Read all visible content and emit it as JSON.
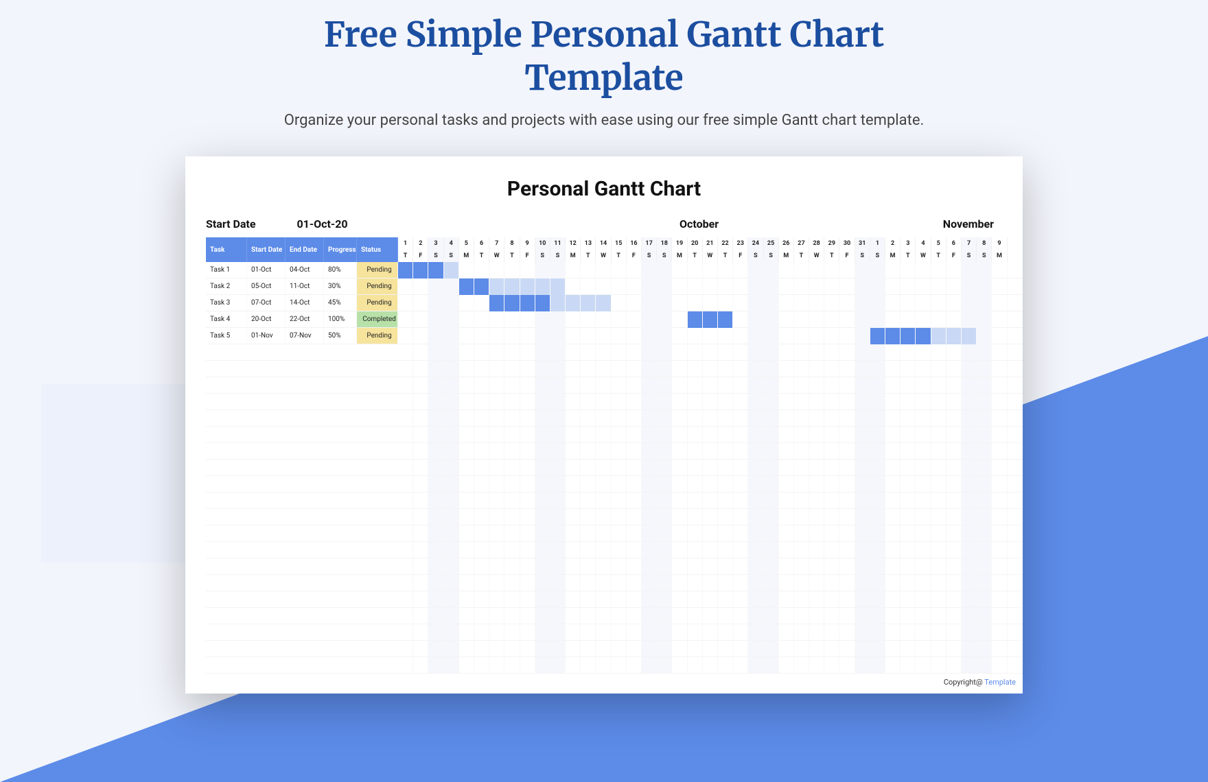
{
  "header": {
    "title": "Free Simple Personal Gantt Chart Template",
    "subtitle": "Organize your personal tasks and projects with ease using our free simple Gantt chart template."
  },
  "preview": {
    "chart_title": "Personal Gantt Chart",
    "start_date_label": "Start Date",
    "start_date_value": "01-Oct-20",
    "month1": "October",
    "month2": "November",
    "task_headers": {
      "task": "Task",
      "start": "Start Date",
      "end": "End Date",
      "progress": "Progress",
      "status": "Status"
    },
    "copyright_prefix": "Copyright@ ",
    "copyright_brand": "Template"
  },
  "chart_data": {
    "type": "gantt",
    "title": "Personal Gantt Chart",
    "start_date": "01-Oct-20",
    "timeline": {
      "start": "2020-10-01",
      "end": "2020-11-09",
      "day_numbers": [
        "1",
        "2",
        "3",
        "4",
        "5",
        "6",
        "7",
        "8",
        "9",
        "10",
        "11",
        "12",
        "13",
        "14",
        "15",
        "16",
        "17",
        "18",
        "19",
        "20",
        "21",
        "22",
        "23",
        "24",
        "25",
        "26",
        "27",
        "28",
        "29",
        "30",
        "31",
        "1",
        "2",
        "3",
        "4",
        "5",
        "6",
        "7",
        "8",
        "9"
      ],
      "day_of_week": [
        "T",
        "F",
        "S",
        "S",
        "M",
        "T",
        "W",
        "T",
        "F",
        "S",
        "S",
        "M",
        "T",
        "W",
        "T",
        "F",
        "S",
        "S",
        "M",
        "T",
        "W",
        "T",
        "F",
        "S",
        "S",
        "M",
        "T",
        "W",
        "T",
        "F",
        "S",
        "S",
        "M",
        "T",
        "W",
        "T",
        "F",
        "S",
        "S",
        "M"
      ],
      "weekend_indices": [
        2,
        3,
        9,
        10,
        16,
        17,
        23,
        24,
        30,
        31,
        37,
        38
      ]
    },
    "tasks": [
      {
        "name": "Task 1",
        "start": "01-Oct",
        "end": "04-Oct",
        "progress": "80%",
        "status": "Pending",
        "bar_start_idx": 0,
        "bar_len": 4,
        "fill_len": 3
      },
      {
        "name": "Task 2",
        "start": "05-Oct",
        "end": "11-Oct",
        "progress": "30%",
        "status": "Pending",
        "bar_start_idx": 4,
        "bar_len": 7,
        "fill_len": 2
      },
      {
        "name": "Task 3",
        "start": "07-Oct",
        "end": "14-Oct",
        "progress": "45%",
        "status": "Pending",
        "bar_start_idx": 6,
        "bar_len": 8,
        "fill_len": 4
      },
      {
        "name": "Task 4",
        "start": "20-Oct",
        "end": "22-Oct",
        "progress": "100%",
        "status": "Completed",
        "bar_start_idx": 19,
        "bar_len": 3,
        "fill_len": 3
      },
      {
        "name": "Task 5",
        "start": "01-Nov",
        "end": "07-Nov",
        "progress": "50%",
        "status": "Pending",
        "bar_start_idx": 31,
        "bar_len": 7,
        "fill_len": 4
      }
    ]
  }
}
